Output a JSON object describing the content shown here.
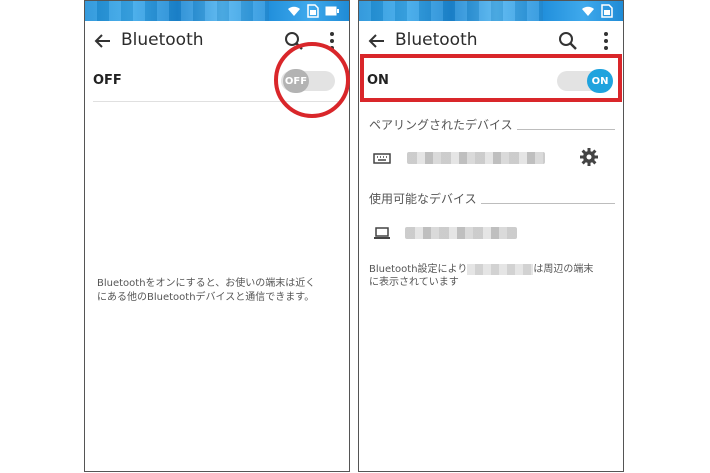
{
  "left_screen": {
    "title": "Bluetooth",
    "switch_label": "OFF",
    "toggle_text": "OFF",
    "info_line1": "BluetoothをオンにするとⅠお使いの端末は近く",
    "info_line2": "にある他のBluetoothデバイスと通信できます。"
  },
  "right_screen": {
    "title": "Bluetooth",
    "switch_label": "ON",
    "toggle_text": "ON",
    "paired_header": "ペアリングされたデバイス",
    "available_header": "使用可能なデバイス",
    "info_part1": "Bluetooth設定により",
    "info_part2": "は周辺の端末",
    "info_line2": "に表示されています"
  },
  "icons": [
    "back-arrow-icon",
    "search-icon",
    "more-vert-icon",
    "wifi-icon",
    "sim-icon",
    "battery-icon",
    "keyboard-icon",
    "laptop-icon",
    "gear-icon"
  ],
  "colors": {
    "accent": "#1fa3de",
    "highlight": "#d9262a",
    "statusbar": "#1e8fd8"
  }
}
